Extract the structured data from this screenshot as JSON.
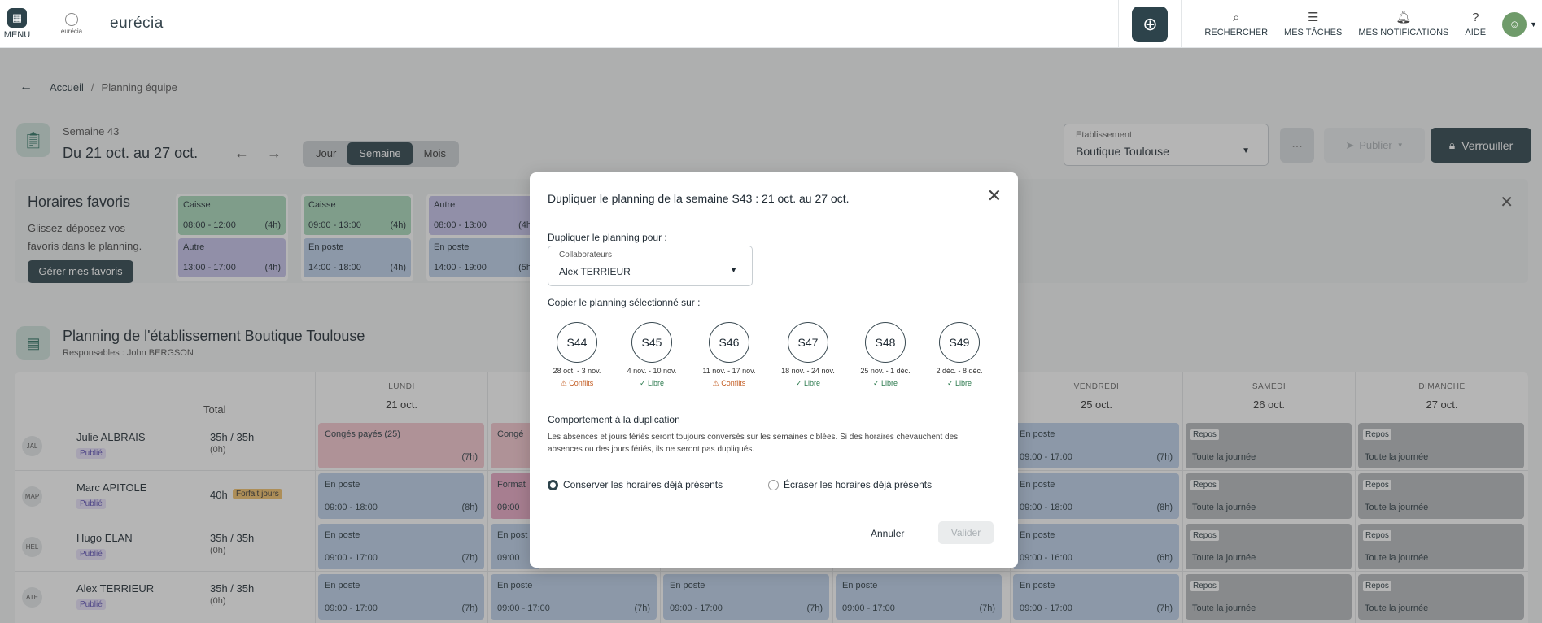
{
  "topbar": {
    "menu_label": "MENU",
    "logo_small": "eurécia",
    "brand": "eurécia",
    "search": "RECHERCHER",
    "tasks": "MES TÂCHES",
    "notifications": "MES NOTIFICATIONS",
    "help": "AIDE"
  },
  "breadcrumb": {
    "home": "Accueil",
    "sep": "/",
    "current": "Planning équipe"
  },
  "week": {
    "label": "Semaine 43",
    "range": "Du 21 oct. au 27 oct.",
    "views": [
      "Jour",
      "Semaine",
      "Mois"
    ],
    "active_view": "Semaine"
  },
  "etablissement": {
    "label": "Etablissement",
    "value": "Boutique Toulouse"
  },
  "actions": {
    "dots": "...",
    "publish": "Publier",
    "lock": "Verrouiller"
  },
  "favorites": {
    "title": "Horaires favoris",
    "desc": "Glissez-déposez vos favoris dans le planning.",
    "manage": "Gérer mes favoris",
    "cards": [
      {
        "slots": [
          {
            "type": "Caisse",
            "hours": "08:00 - 12:00",
            "dur": "(4h)",
            "color": "green"
          },
          {
            "type": "Autre",
            "hours": "13:00 - 17:00",
            "dur": "(4h)",
            "color": "purple"
          }
        ]
      },
      {
        "slots": [
          {
            "type": "Caisse",
            "hours": "09:00 - 13:00",
            "dur": "(4h)",
            "color": "green"
          },
          {
            "type": "En poste",
            "hours": "14:00 - 18:00",
            "dur": "(4h)",
            "color": "blue"
          }
        ]
      },
      {
        "slots": [
          {
            "type": "Autre",
            "hours": "08:00 - 13:00",
            "dur": "(4h",
            "color": "purple"
          },
          {
            "type": "En poste",
            "hours": "14:00 - 19:00",
            "dur": "(5h",
            "color": "blue"
          }
        ]
      }
    ]
  },
  "establishment_planning": {
    "title": "Planning de l'établissement Boutique Toulouse",
    "resp": "Responsables : John BERGSON",
    "total": "Total",
    "days": [
      {
        "name": "LUNDI",
        "date": "21 oct."
      },
      {
        "name": "VENDREDI",
        "date": "25 oct."
      },
      {
        "name": "SAMEDI",
        "date": "26 oct."
      },
      {
        "name": "DIMANCHE",
        "date": "27 oct."
      }
    ],
    "employees": [
      {
        "initials": "JAL",
        "name": "Julie ALBRAIS",
        "status": "Publié",
        "hours": "35h / 35h",
        "sub": "(0h)",
        "forfait": ""
      },
      {
        "initials": "MAP",
        "name": "Marc APITOLE",
        "status": "Publié",
        "hours": "40h",
        "sub": "",
        "forfait": "Forfait jours"
      },
      {
        "initials": "HEL",
        "name": "Hugo ELAN",
        "status": "Publié",
        "hours": "35h / 35h",
        "sub": "(0h)",
        "forfait": ""
      },
      {
        "initials": "ATE",
        "name": "Alex TERRIEUR",
        "status": "Publié",
        "hours": "35h / 35h",
        "sub": "(0h)",
        "forfait": ""
      }
    ],
    "cells": {
      "conges": "Congés payés (25)",
      "conges_short": "Congé",
      "conges_dur": "(7h)",
      "en_poste": "En poste",
      "en_post_cut": "En post",
      "formation": "Format",
      "h_0900_1800": "09:00 - 18:00",
      "d_8h": "(8h)",
      "h_0900_1700": "09:00 - 17:00",
      "d_7h": "(7h)",
      "h_0900_1600": "09:00 - 16:00",
      "d_6h": "(6h)",
      "h_0900_cut": "09:00",
      "repos": "Repos",
      "toute": "Toute la journée"
    }
  },
  "modal": {
    "title": "Dupliquer le planning de la semaine S43 : 21 oct. au 27 oct.",
    "for_label": "Dupliquer le planning pour :",
    "collab_label": "Collaborateurs",
    "collab_value": "Alex TERRIEUR",
    "copy_label": "Copier le planning sélectionné sur :",
    "weeks": [
      {
        "code": "S44",
        "range": "28 oct. - 3 nov.",
        "state": "Conflits",
        "kind": "conf"
      },
      {
        "code": "S45",
        "range": "4 nov. - 10 nov.",
        "state": "Libre",
        "kind": "libre"
      },
      {
        "code": "S46",
        "range": "11 nov. - 17 nov.",
        "state": "Conflits",
        "kind": "conf"
      },
      {
        "code": "S47",
        "range": "18 nov. - 24 nov.",
        "state": "Libre",
        "kind": "libre"
      },
      {
        "code": "S48",
        "range": "25 nov. - 1 déc.",
        "state": "Libre",
        "kind": "libre"
      },
      {
        "code": "S49",
        "range": "2 déc. - 8 déc.",
        "state": "Libre",
        "kind": "libre"
      }
    ],
    "behavior_label": "Comportement à la duplication",
    "behavior_desc": "Les absences et jours fériés seront toujours conversés sur les semaines ciblées. Si des horaires chevauchent des absences ou des jours fériés, ils ne seront pas dupliqués.",
    "option_keep": "Conserver les horaires déjà présents",
    "option_overwrite": "Écraser les horaires déjà présents",
    "cancel": "Annuler",
    "validate": "Valider"
  }
}
